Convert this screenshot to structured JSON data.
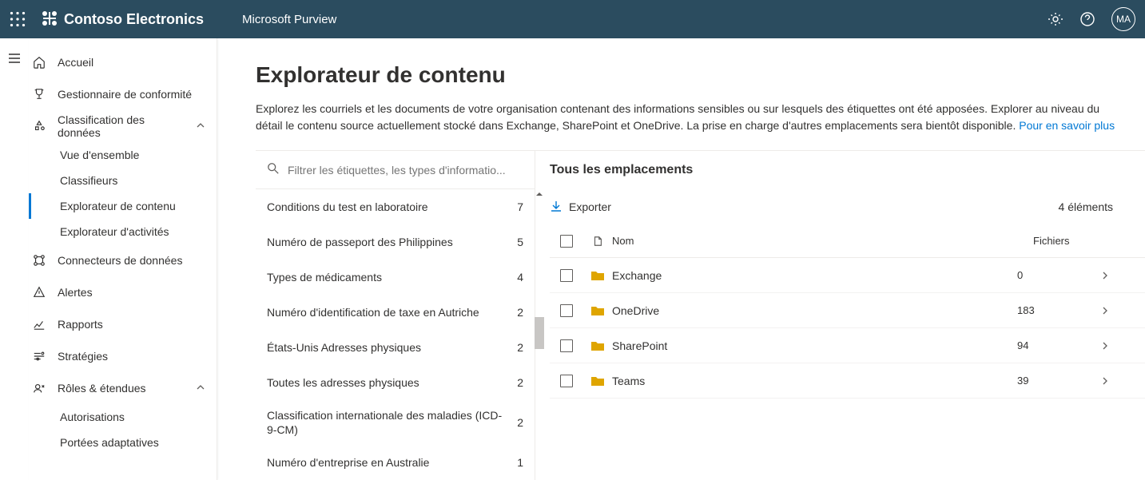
{
  "header": {
    "org": "Contoso Electronics",
    "product": "Microsoft Purview",
    "avatar_initials": "MA"
  },
  "sidebar": {
    "home": "Accueil",
    "compliance": "Gestionnaire de conformité",
    "classification": "Classification des données",
    "classification_children": {
      "overview": "Vue d'ensemble",
      "classifiers": "Classifieurs",
      "content_explorer": "Explorateur de contenu",
      "activity_explorer": "Explorateur d'activités"
    },
    "connectors": "Connecteurs de données",
    "alerts": "Alertes",
    "reports": "Rapports",
    "strategies": "Stratégies",
    "roles": "Rôles & étendues",
    "roles_children": {
      "authorizations": "Autorisations",
      "adaptive_scopes": "Portées adaptatives"
    }
  },
  "page": {
    "title": "Explorateur de contenu",
    "description": "Explorez les courriels et les documents de votre organisation contenant des informations sensibles ou sur lesquels des étiquettes ont été apposées. Explorer au niveau du détail le contenu source actuellement stocké dans Exchange, SharePoint et OneDrive. La prise en charge d'autres emplacements sera bientôt disponible. ",
    "learn_more": "Pour en savoir plus"
  },
  "filter": {
    "placeholder": "Filtrer les étiquettes, les types d'informatio...",
    "rows": [
      {
        "label": "Conditions du test en laboratoire",
        "count": "7"
      },
      {
        "label": "Numéro de passeport des Philippines",
        "count": "5"
      },
      {
        "label": "Types de médicaments",
        "count": "4"
      },
      {
        "label": "Numéro d'identification de taxe en Autriche",
        "count": "2"
      },
      {
        "label": "États-Unis Adresses physiques",
        "count": "2"
      },
      {
        "label": "Toutes les adresses physiques",
        "count": "2"
      },
      {
        "label": "Classification internationale des maladies (ICD-9-CM)",
        "count": "2"
      },
      {
        "label": "Numéro d'entreprise en Australie",
        "count": "1"
      }
    ]
  },
  "locations": {
    "panel_title": "Tous les emplacements",
    "export_label": "Exporter",
    "count_text": "4 éléments",
    "col_name": "Nom",
    "col_files": "Fichiers",
    "rows": [
      {
        "name": "Exchange",
        "files": "0"
      },
      {
        "name": "OneDrive",
        "files": "183"
      },
      {
        "name": "SharePoint",
        "files": "94"
      },
      {
        "name": "Teams",
        "files": "39"
      }
    ]
  }
}
